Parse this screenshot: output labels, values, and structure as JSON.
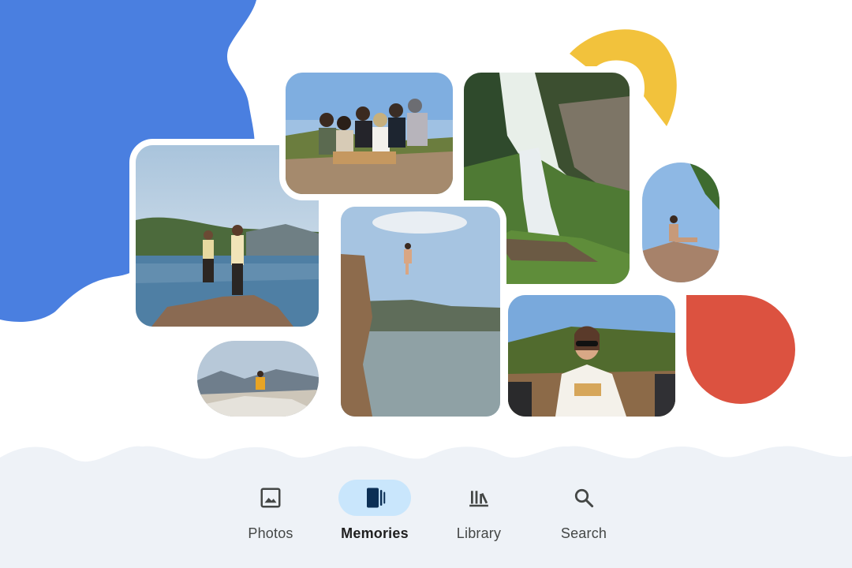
{
  "nav": {
    "items": [
      {
        "label": "Photos",
        "icon": "photo-icon",
        "active": false
      },
      {
        "label": "Memories",
        "icon": "memories-icon",
        "active": true
      },
      {
        "label": "Library",
        "icon": "library-icon",
        "active": false
      },
      {
        "label": "Search",
        "icon": "search-icon",
        "active": false
      }
    ]
  },
  "colors": {
    "blue_shape": "#4a7fe0",
    "yellow_shape": "#f2c23c",
    "red_shape": "#dc5240",
    "nav_bg": "#eef2f7",
    "active_pill": "#c9e6fc"
  },
  "photos": [
    {
      "subject": "two hikers standing on rocks by a lake"
    },
    {
      "subject": "group of friends sitting on rocks"
    },
    {
      "subject": "waterfall in forest"
    },
    {
      "subject": "person sitting on a rock"
    },
    {
      "subject": "person sitting on rocks overlooking mountains"
    },
    {
      "subject": "person jumping from cliff into lake"
    },
    {
      "subject": "woman with sunglasses outdoors"
    }
  ]
}
